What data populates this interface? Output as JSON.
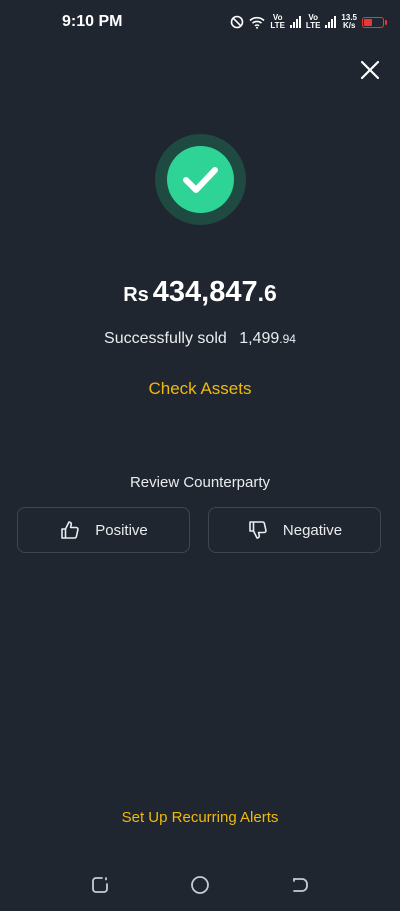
{
  "status_bar": {
    "time": "9:10 PM",
    "volte_1_top": "Vo",
    "volte_1_bottom": "LTE",
    "volte_2_top": "Vo",
    "volte_2_bottom": "LTE",
    "net_speed_value": "13.5",
    "net_speed_unit": "K/s"
  },
  "result": {
    "currency": "Rs",
    "amount_integer": "434,847",
    "amount_decimal": ".6",
    "sold_label": "Successfully sold",
    "sold_qty_main": "1,499",
    "sold_qty_small": ".94",
    "check_assets_label": "Check Assets"
  },
  "review": {
    "title": "Review Counterparty",
    "positive_label": "Positive",
    "negative_label": "Negative"
  },
  "footer": {
    "recurring_label": "Set Up Recurring Alerts"
  },
  "colors": {
    "background": "#1f2630",
    "accent": "#f0b90b",
    "success": "#2ed396"
  }
}
